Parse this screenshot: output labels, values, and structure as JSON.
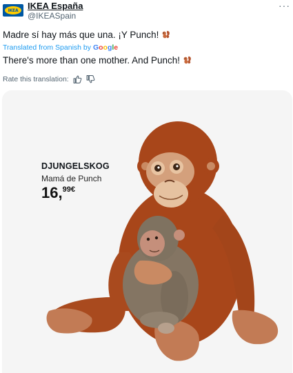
{
  "author": {
    "display_name": "IKEA España",
    "handle": "@IKEASpain",
    "logo_text": "IKEA"
  },
  "tweet": {
    "original_text": "Madre sí hay más que una. ¡Y Punch!",
    "translated_label": "Translated from Spanish by",
    "translator_brand": [
      "G",
      "o",
      "o",
      "g",
      "l",
      "e"
    ],
    "translation_text": "There's more than one mother. And Punch!",
    "rate_label": "Rate this translation:",
    "more_label": "···"
  },
  "product": {
    "name": "DJUNGELSKOG",
    "subtitle": "Mamá de Punch",
    "price_int": "16",
    "price_comma": ",",
    "price_dec": "99",
    "price_currency": "€"
  },
  "icons": {
    "emoji": "squirrel-icon",
    "rate_up": "thumbs-up-icon",
    "rate_down": "thumbs-down-icon",
    "more": "more-icon"
  },
  "colors": {
    "link": "#1d9bf0",
    "ikea_blue": "#0058a3",
    "ikea_yellow": "#ffcc00",
    "secondary_text": "#536471"
  }
}
